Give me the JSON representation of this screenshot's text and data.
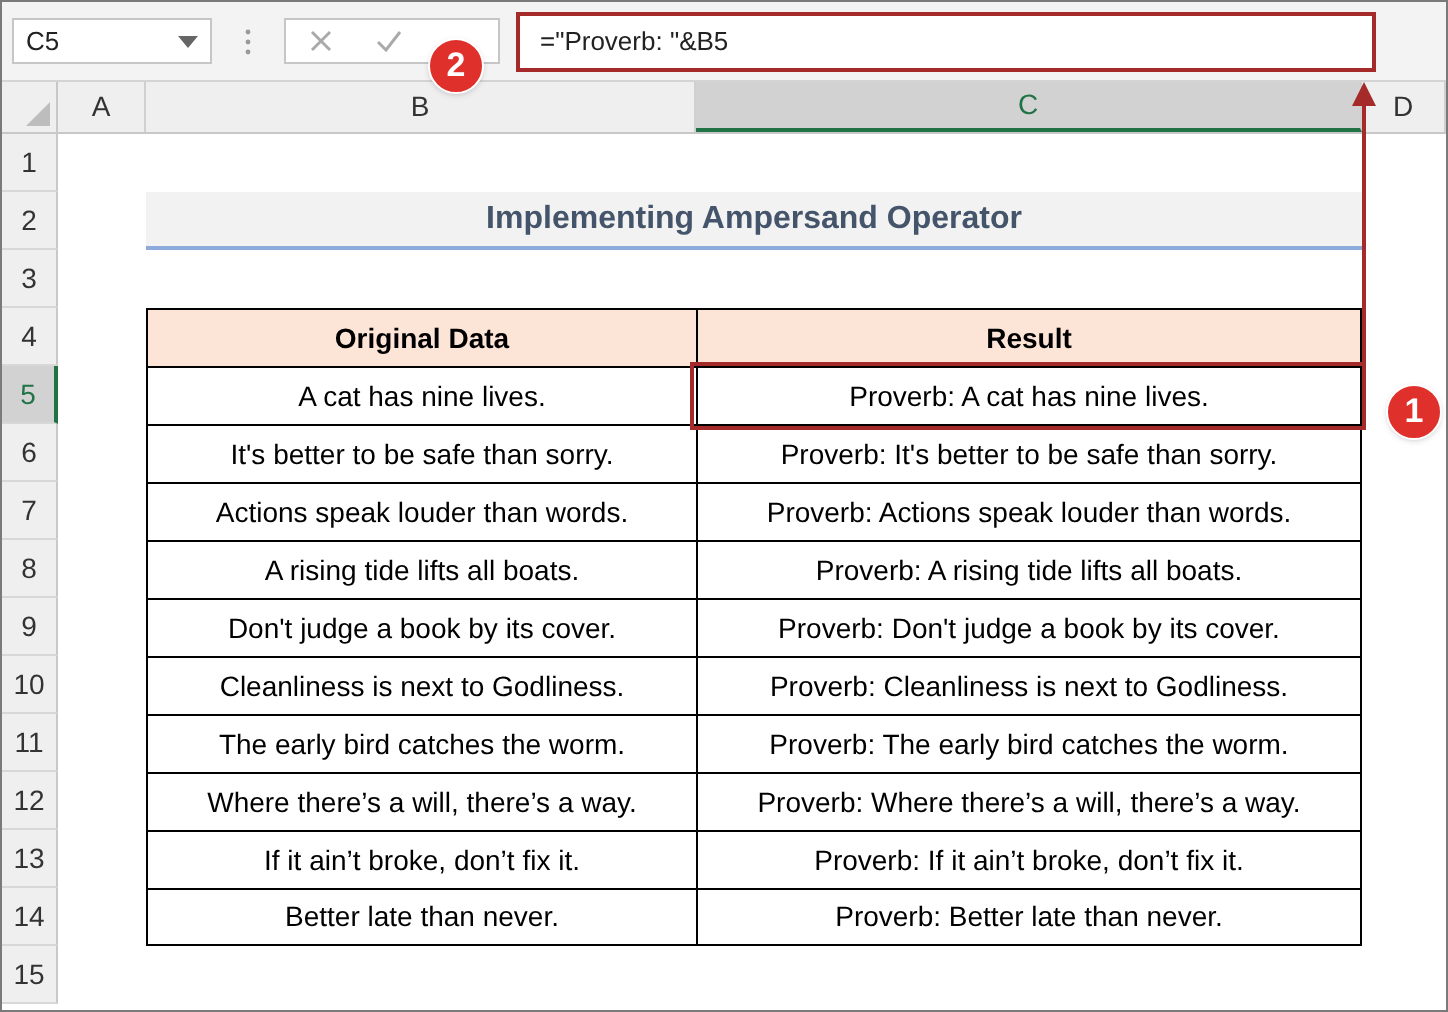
{
  "name_box": "C5",
  "formula": "=\"Proverb: \"&B5",
  "columns": [
    {
      "label": "A",
      "selected": false
    },
    {
      "label": "B",
      "selected": false
    },
    {
      "label": "C",
      "selected": true
    },
    {
      "label": "D",
      "selected": false
    }
  ],
  "rows": [
    {
      "label": "1",
      "selected": false
    },
    {
      "label": "2",
      "selected": false
    },
    {
      "label": "3",
      "selected": false
    },
    {
      "label": "4",
      "selected": false
    },
    {
      "label": "5",
      "selected": true
    },
    {
      "label": "6",
      "selected": false
    },
    {
      "label": "7",
      "selected": false
    },
    {
      "label": "8",
      "selected": false
    },
    {
      "label": "9",
      "selected": false
    },
    {
      "label": "10",
      "selected": false
    },
    {
      "label": "11",
      "selected": false
    },
    {
      "label": "12",
      "selected": false
    },
    {
      "label": "13",
      "selected": false
    },
    {
      "label": "14",
      "selected": false
    },
    {
      "label": "15",
      "selected": false
    }
  ],
  "title": "Implementing Ampersand Operator",
  "table": {
    "columns": [
      "Original Data",
      "Result"
    ],
    "rows": [
      [
        "A cat has nine lives.",
        "Proverb: A cat has nine lives."
      ],
      [
        "It's better to be safe than sorry.",
        "Proverb: It's better to be safe than sorry."
      ],
      [
        "Actions speak louder than words.",
        "Proverb: Actions speak louder than words."
      ],
      [
        "A rising tide lifts all boats.",
        "Proverb: A rising tide lifts all boats."
      ],
      [
        "Don't judge a book by its cover.",
        "Proverb: Don't judge a book by its cover."
      ],
      [
        "Cleanliness is next to Godliness.",
        "Proverb: Cleanliness is next to Godliness."
      ],
      [
        "The early bird catches the worm.",
        "Proverb: The early bird catches the worm."
      ],
      [
        "Where there’s a will, there’s a way.",
        "Proverb: Where there’s a will, there’s a way."
      ],
      [
        "If it ain’t broke, don’t fix it.",
        "Proverb: If it ain’t broke, don’t fix it."
      ],
      [
        "Better late than never.",
        "Proverb: Better late than never."
      ]
    ]
  },
  "callouts": [
    {
      "label": "1"
    },
    {
      "label": "2"
    }
  ]
}
